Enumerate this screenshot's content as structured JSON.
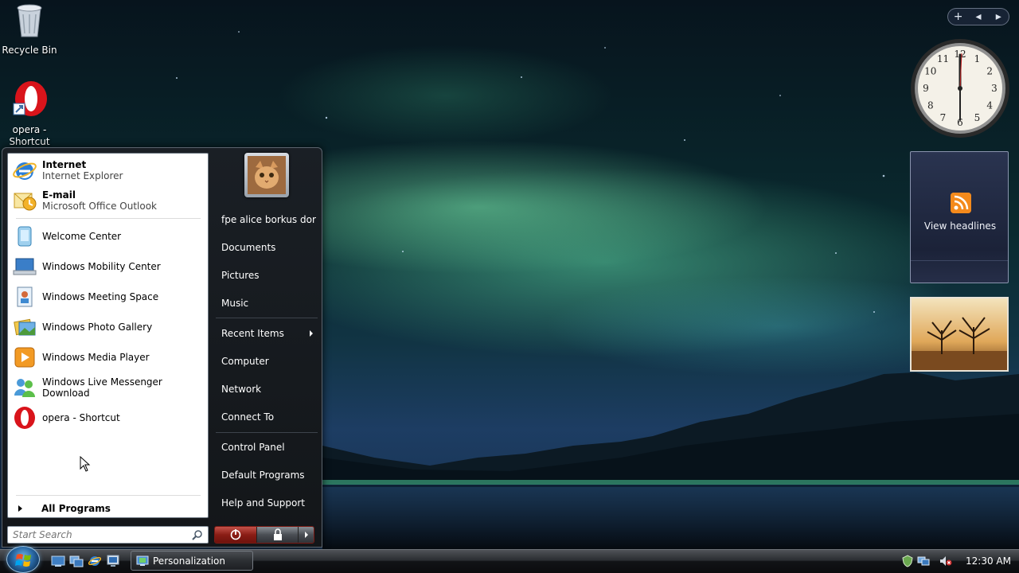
{
  "desktop": {
    "icons": [
      {
        "label": "Recycle Bin"
      },
      {
        "label": "opera - Shortcut"
      }
    ]
  },
  "gadgets": {
    "controls": {
      "add": "+",
      "prev": "◂",
      "next": "▸"
    },
    "clock": {
      "numerals": [
        "12",
        "1",
        "2",
        "3",
        "4",
        "5",
        "6",
        "7",
        "8",
        "9",
        "10",
        "11"
      ],
      "time_shown": "12:30"
    },
    "feed": {
      "label": "View headlines"
    }
  },
  "start_menu": {
    "pinned": [
      {
        "title": "Internet",
        "subtitle": "Internet Explorer",
        "icon": "internet-explorer-icon"
      },
      {
        "title": "E-mail",
        "subtitle": "Microsoft Office Outlook",
        "icon": "outlook-icon"
      }
    ],
    "recent": [
      {
        "label": "Welcome Center",
        "icon": "welcome-center-icon"
      },
      {
        "label": "Windows Mobility Center",
        "icon": "mobility-center-icon"
      },
      {
        "label": "Windows Meeting Space",
        "icon": "meeting-space-icon"
      },
      {
        "label": "Windows Photo Gallery",
        "icon": "photo-gallery-icon"
      },
      {
        "label": "Windows Media Player",
        "icon": "media-player-icon"
      },
      {
        "label": "Windows Live Messenger Download",
        "icon": "messenger-icon"
      },
      {
        "label": "opera - Shortcut",
        "icon": "opera-icon"
      }
    ],
    "all_programs": "All Programs",
    "search": {
      "placeholder": "Start Search",
      "value": ""
    },
    "user": {
      "name": "fpe alice borkus dor"
    },
    "places": [
      {
        "label": "Documents"
      },
      {
        "label": "Pictures"
      },
      {
        "label": "Music"
      },
      {
        "label": "Recent Items",
        "has_submenu": true
      },
      {
        "label": "Computer"
      },
      {
        "label": "Network"
      },
      {
        "label": "Connect To"
      },
      {
        "label": "Control Panel"
      },
      {
        "label": "Default Programs"
      },
      {
        "label": "Help and Support"
      }
    ]
  },
  "taskbar": {
    "quick_launch": [
      "show-desktop-icon",
      "switch-windows-icon",
      "internet-explorer-icon",
      "media-center-icon"
    ],
    "tasks": [
      {
        "label": "Personalization"
      }
    ],
    "clock": "12:30 AM",
    "tray_icons": [
      "windows-defender-icon",
      "network-icon",
      "volume-muted-icon"
    ]
  }
}
